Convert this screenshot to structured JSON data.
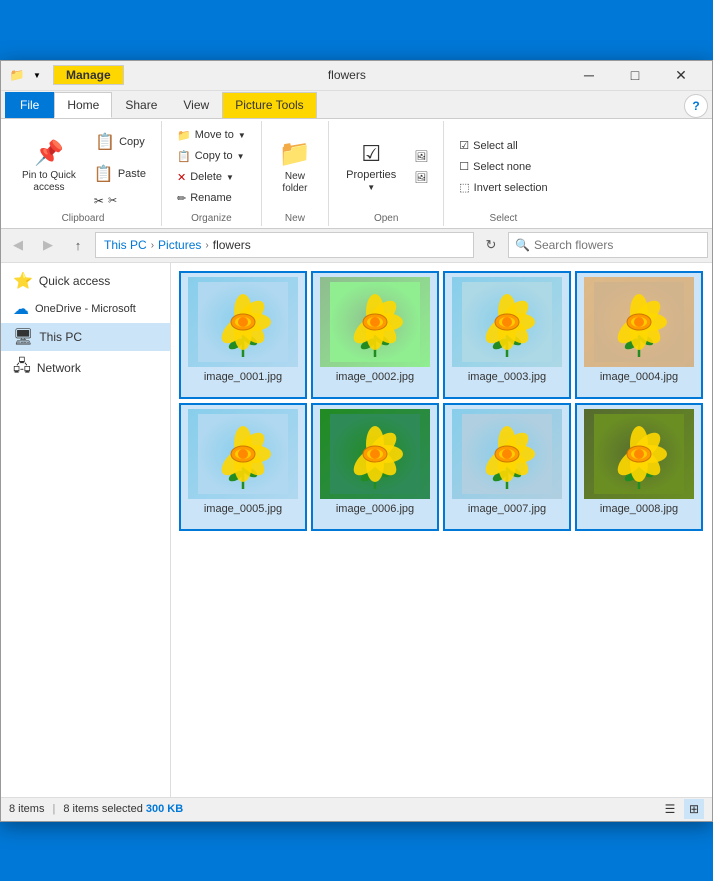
{
  "window": {
    "title": "flowers",
    "manage_label": "Manage",
    "minimize": "─",
    "maximize": "□",
    "close": "✕"
  },
  "tabs": {
    "file": "File",
    "home": "Home",
    "share": "Share",
    "view": "View",
    "picture_tools": "Picture Tools",
    "manage": "Manage"
  },
  "ribbon": {
    "clipboard": {
      "label": "Clipboard",
      "pin_label": "Pin to Quick\naccess",
      "copy_label": "Copy",
      "paste_label": "Paste",
      "cut_icon": "✂"
    },
    "organize": {
      "label": "Organize",
      "move_to": "Move to",
      "copy_to": "Copy to",
      "delete": "Delete",
      "rename": "Rename"
    },
    "new": {
      "label": "New",
      "new_folder": "New\nfolder"
    },
    "open": {
      "label": "Open",
      "properties": "Properties"
    },
    "select": {
      "label": "Select",
      "select_all": "Select all",
      "select_none": "Select none",
      "invert_selection": "Invert selection"
    }
  },
  "address": {
    "this_pc": "This PC",
    "pictures": "Pictures",
    "flowers": "flowers",
    "search_placeholder": "Search flowers"
  },
  "sidebar": {
    "items": [
      {
        "id": "quick-access",
        "label": "Quick access",
        "icon": "⭐"
      },
      {
        "id": "onedrive",
        "label": "OneDrive - Microsoft",
        "icon": "☁"
      },
      {
        "id": "this-pc",
        "label": "This PC",
        "icon": "💻",
        "selected": true
      },
      {
        "id": "network",
        "label": "Network",
        "icon": "🖧"
      }
    ]
  },
  "files": [
    {
      "id": 1,
      "name": "image_0001.jpg",
      "bg": "flower-1"
    },
    {
      "id": 2,
      "name": "image_0002.jpg",
      "bg": "flower-2"
    },
    {
      "id": 3,
      "name": "image_0003.jpg",
      "bg": "flower-3"
    },
    {
      "id": 4,
      "name": "image_0004.jpg",
      "bg": "flower-4"
    },
    {
      "id": 5,
      "name": "image_0005.jpg",
      "bg": "flower-5"
    },
    {
      "id": 6,
      "name": "image_0006.jpg",
      "bg": "flower-6"
    },
    {
      "id": 7,
      "name": "image_0007.jpg",
      "bg": "flower-7"
    },
    {
      "id": 8,
      "name": "image_0008.jpg",
      "bg": "flower-8"
    }
  ],
  "status": {
    "items_count": "8 items",
    "selected_text": "8 items selected",
    "size": "300 KB"
  }
}
